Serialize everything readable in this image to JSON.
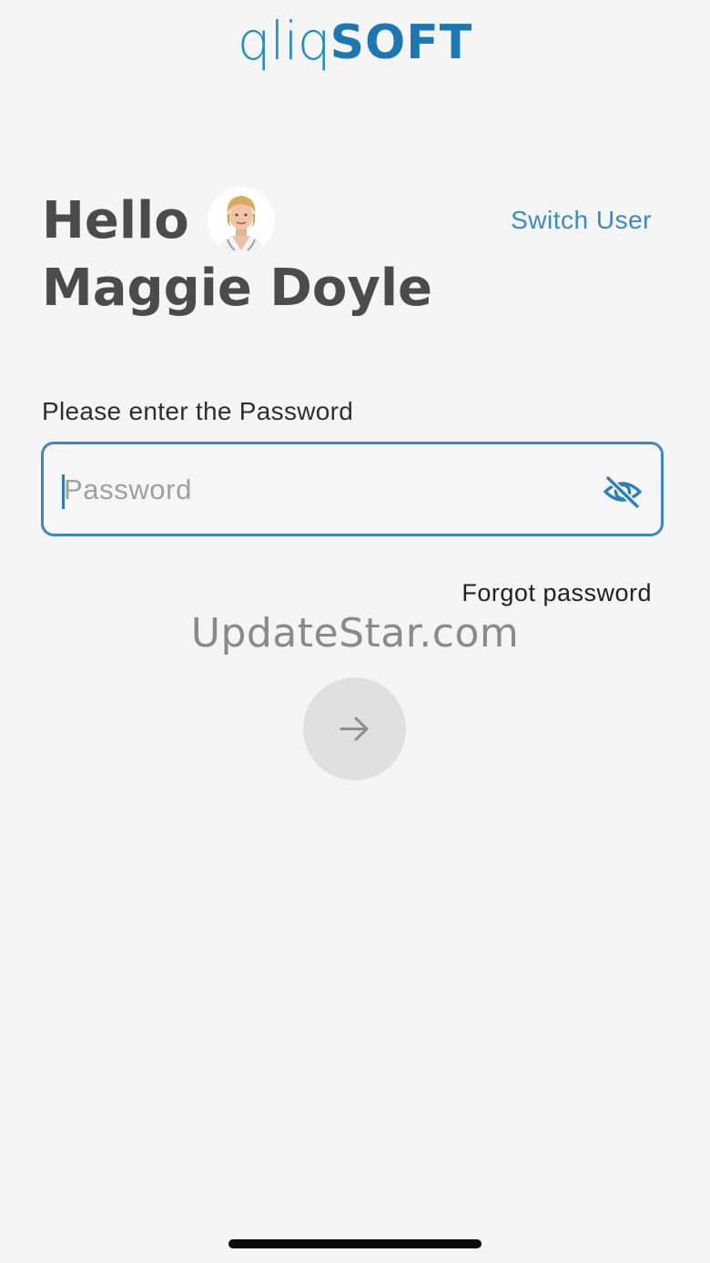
{
  "brand": {
    "logo_light": "qliq",
    "logo_bold": "SOFT"
  },
  "greeting": {
    "hello": "Hello",
    "user_name": "Maggie Doyle"
  },
  "header": {
    "switch_user_label": "Switch User"
  },
  "login": {
    "prompt": "Please enter the Password",
    "password_placeholder": "Password",
    "password_value": "",
    "forgot_label": "Forgot password"
  },
  "icons": {
    "visibility_toggle": "eye-off-icon",
    "submit": "arrow-right-icon"
  },
  "watermark": "UpdateStar.com",
  "colors": {
    "accent": "#3d87c4",
    "brand_blue": "#1b78b4",
    "background": "#f5f5f5",
    "button_disabled": "#e0e0e0"
  }
}
